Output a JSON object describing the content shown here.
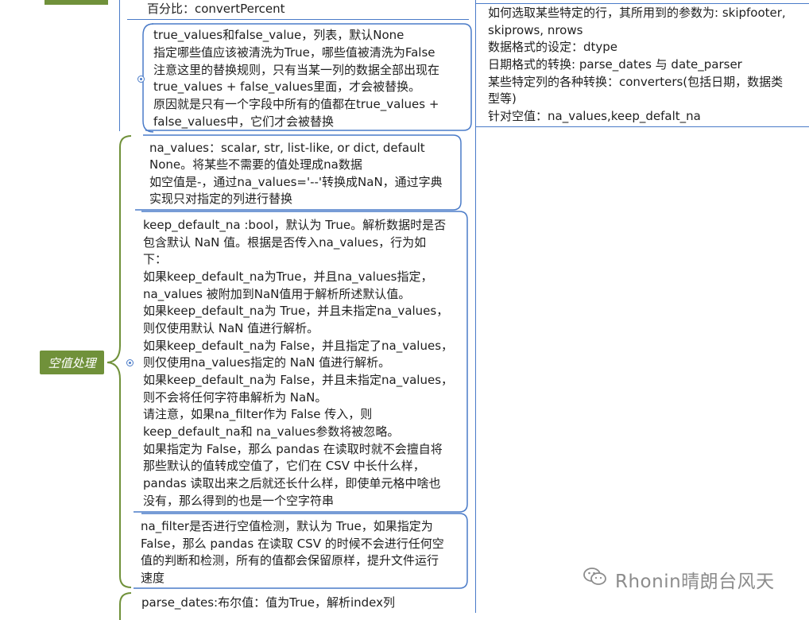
{
  "top_left": {
    "percent_line": "百分比：convertPercent"
  },
  "true_values_node": {
    "lines": [
      "true_values和false_value，列表，默认None",
      "指定哪些值应该被清洗为True，哪些值被清洗为False",
      "注意这里的替换规则，只有当某一列的数据全部出现在",
      "true_values + false_values里面，才会被替换。",
      "原因就是只有一个字段中所有的值都在true_values +",
      "false_values中，它们才会被替换"
    ]
  },
  "category": {
    "label": "空值处理"
  },
  "na_values_node": {
    "lines": [
      "na_values：scalar, str, list-like, or dict, default",
      "None。将某些不需要的值处理成na数据",
      "如空值是-，通过na_values='--'转换成NaN，通过字典",
      "实现只对指定的列进行替换"
    ]
  },
  "keep_default_na_node": {
    "lines": [
      "keep_default_na :bool，默认为 True。解析数据时是否",
      "包含默认 NaN 值。根据是否传入na_values，行为如",
      "下：",
      "如果keep_default_na为True，并且na_values指定，",
      "na_values 被附加到NaN值用于解析所述默认值。",
      "如果keep_default_na为 True，并且未指定na_values，",
      "则仅使用默认 NaN 值进行解析。",
      "如果keep_default_na为 False，并且指定了na_values，",
      "则仅使用na_values指定的 NaN 值进行解析。",
      "如果keep_default_na为 False，并且未指定na_values，",
      "则不会将任何字符串解析为 NaN。",
      "请注意，如果na_filter作为 False 传入，则",
      "keep_default_na和 na_values参数将被忽略。",
      "如果指定为 False，那么 pandas 在读取时就不会擅自将",
      "那些默认的值转成空值了，它们在 CSV 中长什么样，",
      "pandas 读取出来之后就还长什么样，即使单元格中啥也",
      "没有，那么得到的也是一个空字符串"
    ]
  },
  "na_filter_node": {
    "lines": [
      "na_filter是否进行空值检测，默认为 True，如果指定为",
      "False，那么 pandas 在读取 CSV 的时候不会进行任何空",
      "值的判断和检测，所有的值都会保留原样，提升文件运行",
      "速度"
    ]
  },
  "parse_dates_node": {
    "text": "parse_dates:布尔值：值为True，解析index列"
  },
  "right_panel": {
    "lines": [
      "如何选取某些特定的行，其所用到的参数为: skipfooter,",
      "skiprows, nrows",
      "数据格式的设定：dtype",
      "日期格式的转换: parse_dates 与 date_parser",
      "某些特定列的各种转换：converters(包括日期，数据类",
      "型等)",
      "针对空值：na_values,keep_defalt_na"
    ]
  },
  "watermark": {
    "icon": "wechat-icon",
    "text": "Rhonin晴朗台风天"
  },
  "colors": {
    "line": "#4a7bc8",
    "tag_bg": "#70913a",
    "tag_text": "#ffffff",
    "text": "#1f1f1f",
    "watermark": "#8c8c8c"
  }
}
